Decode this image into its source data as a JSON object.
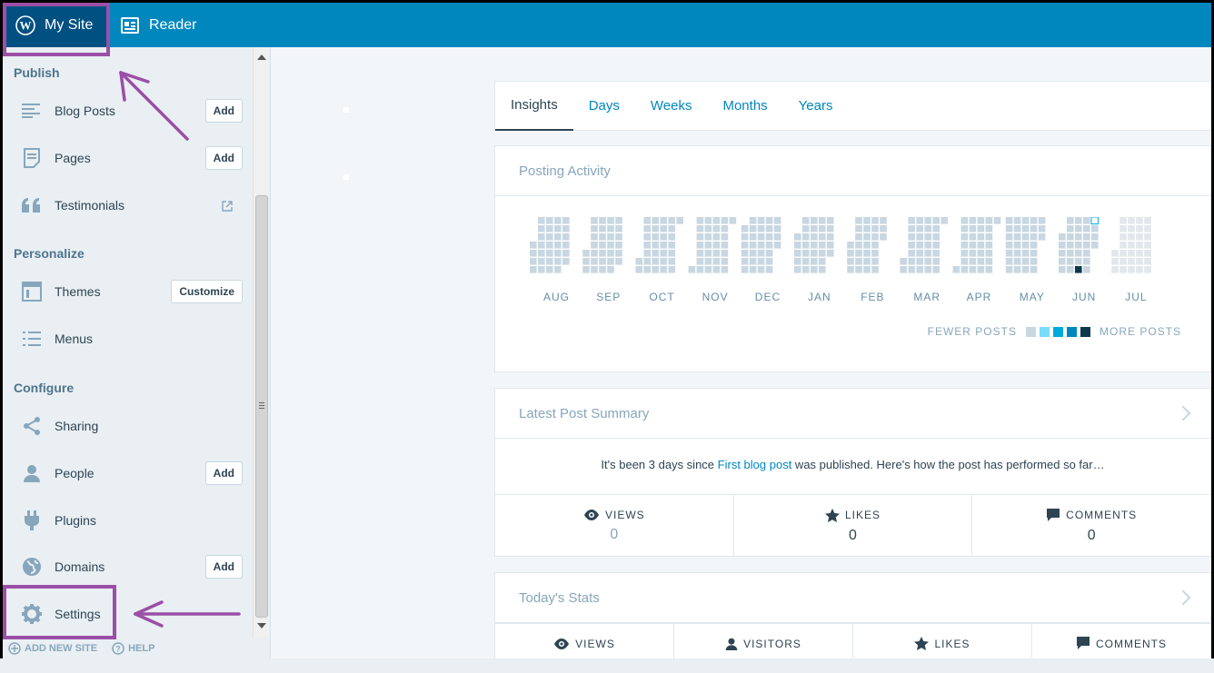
{
  "masterbar": {
    "my_site": "My Site",
    "reader": "Reader"
  },
  "sidebar": {
    "publish_heading": "Publish",
    "personalize_heading": "Personalize",
    "configure_heading": "Configure",
    "items": [
      {
        "label": "Blog Posts",
        "icon": "posts-icon",
        "button": "Add"
      },
      {
        "label": "Pages",
        "icon": "pages-icon",
        "button": "Add"
      },
      {
        "label": "Testimonials",
        "icon": "quote-icon",
        "external": true
      },
      {
        "label": "Themes",
        "icon": "themes-icon",
        "button": "Customize"
      },
      {
        "label": "Menus",
        "icon": "menus-icon"
      },
      {
        "label": "Sharing",
        "icon": "share-icon"
      },
      {
        "label": "People",
        "icon": "person-icon",
        "button": "Add"
      },
      {
        "label": "Plugins",
        "icon": "plug-icon"
      },
      {
        "label": "Domains",
        "icon": "globe-icon",
        "button": "Add"
      },
      {
        "label": "Settings",
        "icon": "gear-icon"
      }
    ],
    "footer": {
      "add_site": "ADD NEW SITE",
      "help": "HELP"
    }
  },
  "tabs": [
    {
      "label": "Insights",
      "active": true
    },
    {
      "label": "Days"
    },
    {
      "label": "Weeks"
    },
    {
      "label": "Months"
    },
    {
      "label": "Years"
    }
  ],
  "posting_activity": {
    "title": "Posting Activity",
    "months": [
      "AUG",
      "SEP",
      "OCT",
      "NOV",
      "DEC",
      "JAN",
      "FEB",
      "MAR",
      "APR",
      "MAY",
      "JUN",
      "JUL"
    ],
    "legend_fewer": "FEWER POSTS",
    "legend_more": "MORE POSTS",
    "legend_colors": [
      "#c8d7e1",
      "#78dcfa",
      "#00aadc",
      "#0085be",
      "#0b374f"
    ]
  },
  "latest_post": {
    "title": "Latest Post Summary",
    "text_before": "It's been 3 days since ",
    "link": "First blog post",
    "text_after": " was published. Here's how the post has performed so far…",
    "stats": [
      {
        "label": "VIEWS",
        "icon": "eye-icon",
        "value": "0"
      },
      {
        "label": "LIKES",
        "icon": "star-icon",
        "value": "0"
      },
      {
        "label": "COMMENTS",
        "icon": "comment-icon",
        "value": "0"
      }
    ]
  },
  "todays_stats": {
    "title": "Today's Stats",
    "stats": [
      {
        "label": "VIEWS",
        "icon": "eye-icon"
      },
      {
        "label": "VISITORS",
        "icon": "person-icon"
      },
      {
        "label": "LIKES",
        "icon": "star-icon"
      },
      {
        "label": "COMMENTS",
        "icon": "comment-icon"
      }
    ]
  }
}
